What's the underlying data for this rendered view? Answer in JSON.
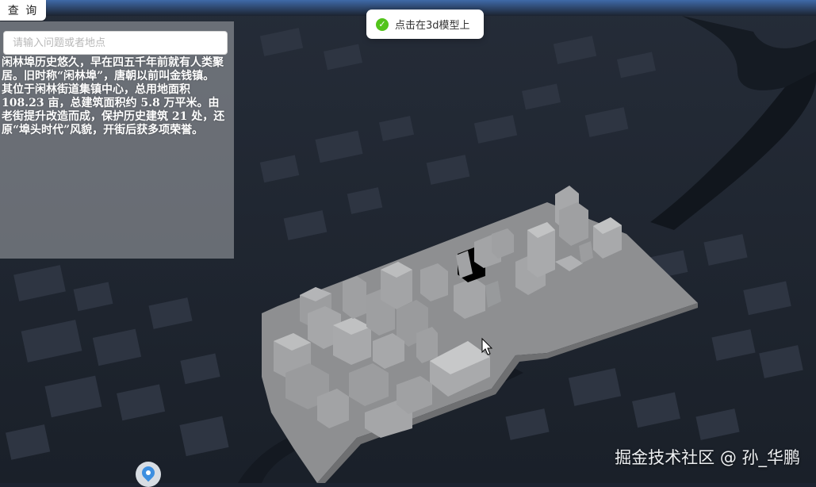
{
  "query_button": {
    "label": "查 询"
  },
  "panel": {
    "search_placeholder": "请输入问题或者地点",
    "info_text": "闲林埠历史悠久，早在四五千年前就有人类聚居。旧时称“闲林埠”，唐朝以前叫金钱镇。其位于闲林街道集镇中心，总用地面积 108.23 亩，总建筑面积约 5.8 万平米。由老街提升改造而成，保护历史建筑 21 处，还原“埠头时代”风貌，开街后获多项荣誉。"
  },
  "toast": {
    "icon": "check-circle-icon",
    "message": "点击在3d模型上"
  },
  "watermark": "掘金技术社区 @ 孙_华鹏",
  "map": {
    "location_pin_icon": "location-pin-icon",
    "cursor_icon": "mouse-cursor-icon"
  },
  "colors": {
    "background": "#1c2330",
    "model_gray": "#8e8f91",
    "toast_success": "#52c41a",
    "pin_blue": "#3d8fe0"
  }
}
